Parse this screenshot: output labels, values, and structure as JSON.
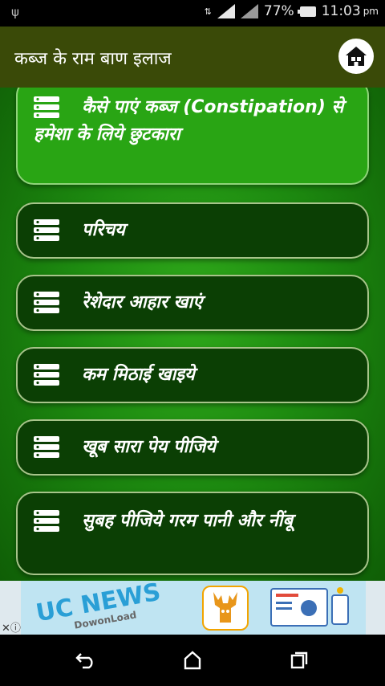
{
  "status_bar": {
    "battery_percent": "77%",
    "time": "11:03",
    "time_suffix": "pm",
    "icons": [
      "usb-icon",
      "data-arrows-icon",
      "signal-icon",
      "battery-icon"
    ]
  },
  "app_bar": {
    "title": "कब्ज के राम बाण इलाज",
    "home_icon": "home-icon"
  },
  "menu": {
    "items": [
      {
        "label": "कैसे पाएं कब्ज (Constipation) से हमेशा के लिये छुटकारा",
        "selected": true
      },
      {
        "label": "परिचय"
      },
      {
        "label": "रेशेदार आहार खाएं"
      },
      {
        "label": "कम मिठाई खाइये"
      },
      {
        "label": "खूब सारा पेय पीजिये"
      },
      {
        "label": "सुबह पीजिये गरम पानी और नींबू"
      }
    ]
  },
  "ad": {
    "headline": "UC NEWS",
    "subline": "DowonLoad"
  },
  "colors": {
    "app_bar": "#3a4a08",
    "card": "#0b3f04",
    "card_selected": "#29a514",
    "background": "#1d8a10"
  }
}
